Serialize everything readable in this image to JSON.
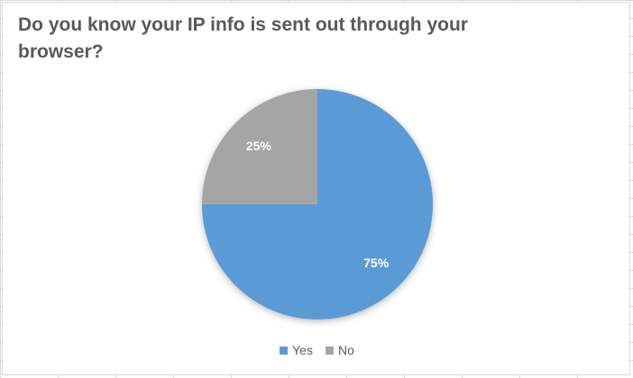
{
  "chart_data": {
    "type": "pie",
    "title": "Do you know your IP info is sent out through your browser?",
    "categories": [
      "Yes",
      "No"
    ],
    "values": [
      75,
      25
    ],
    "data_labels": [
      "75%",
      "25%"
    ],
    "colors": [
      "#5b9bd5",
      "#a5a5a5"
    ],
    "legend_position": "bottom"
  }
}
